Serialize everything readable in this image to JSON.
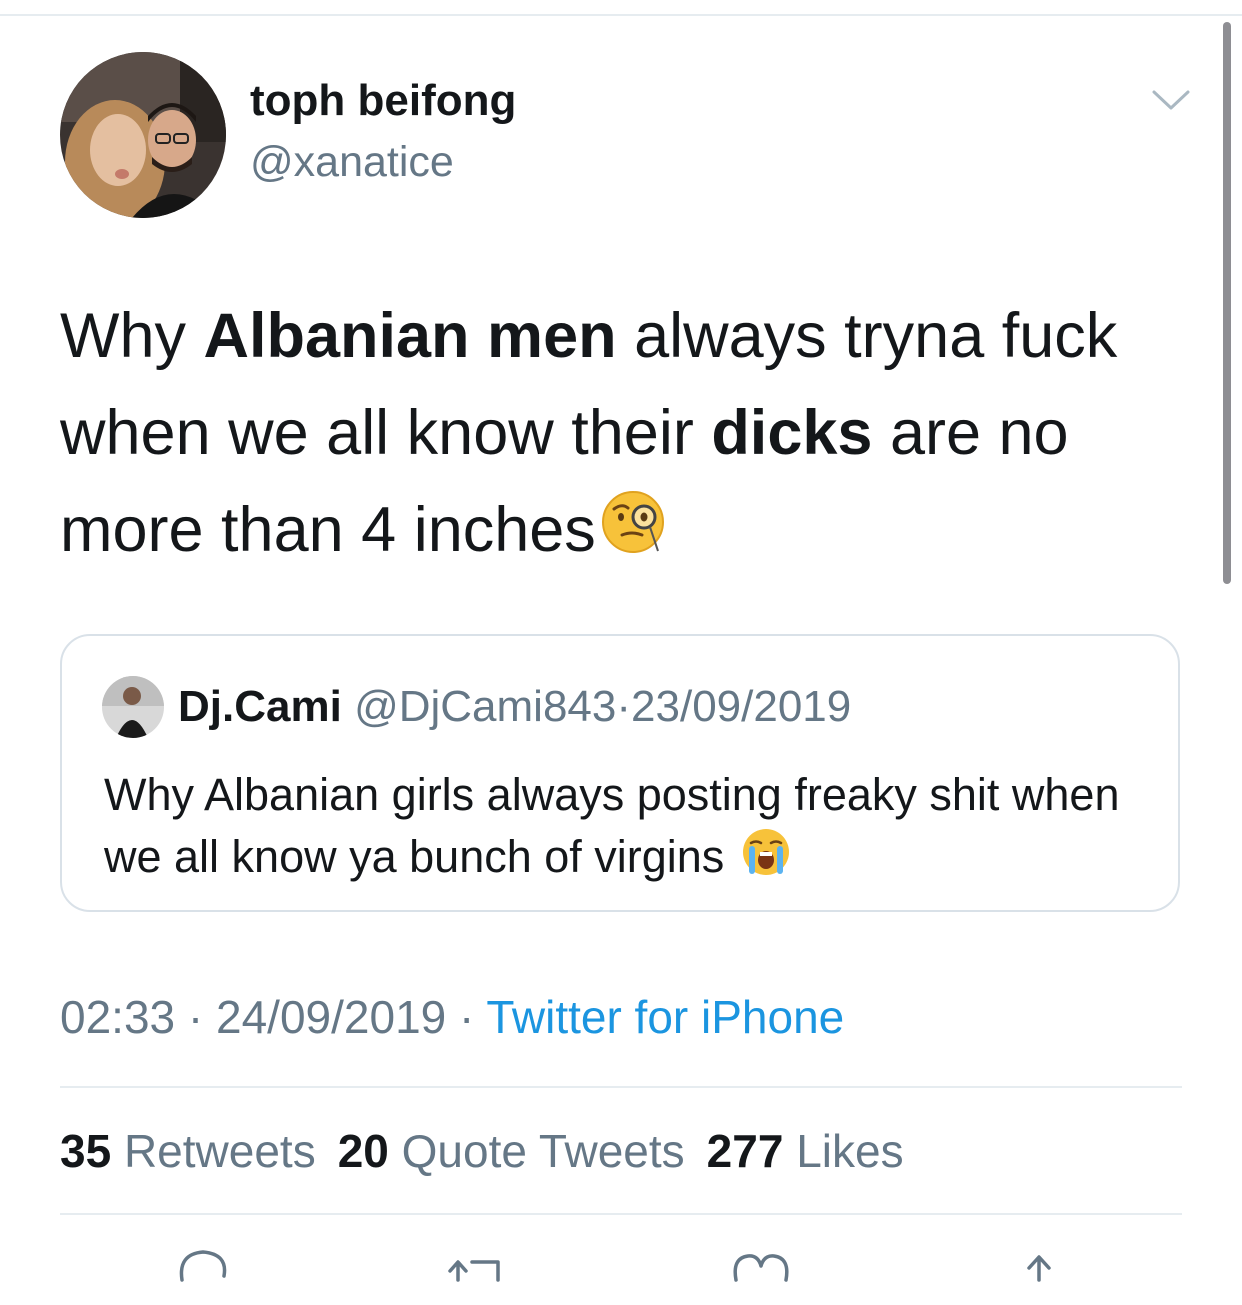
{
  "tweet": {
    "author_name": "toph beifong",
    "author_handle": "@xanatice",
    "text_parts": {
      "p1": "Why ",
      "p2": "Albanian men",
      "p3": " always tryna fuck when we all know their ",
      "p4": "dicks",
      "p5": " are no more than 4 inches"
    },
    "emoji": "face-with-monocle",
    "time": "02:33",
    "date": "24/09/2019",
    "separator": "·",
    "source": "Twitter for iPhone"
  },
  "quote": {
    "name": "Dj.Cami",
    "handle": "@DjCami843",
    "separator": "·",
    "date": "23/09/2019",
    "text": "Why Albanian girls always posting freaky shit when we all know ya bunch of virgins",
    "emoji": "loudly-crying-face"
  },
  "stats": {
    "retweets_count": "35",
    "retweets_label": "Retweets",
    "quotes_count": "20",
    "quotes_label": "Quote Tweets",
    "likes_count": "277",
    "likes_label": "Likes"
  },
  "actions": [
    "reply-icon",
    "retweet-icon",
    "like-icon",
    "share-icon"
  ],
  "colors": {
    "text": "#14171a",
    "secondary": "#657786",
    "link": "#1b95e0",
    "border": "#e6ecf0"
  }
}
